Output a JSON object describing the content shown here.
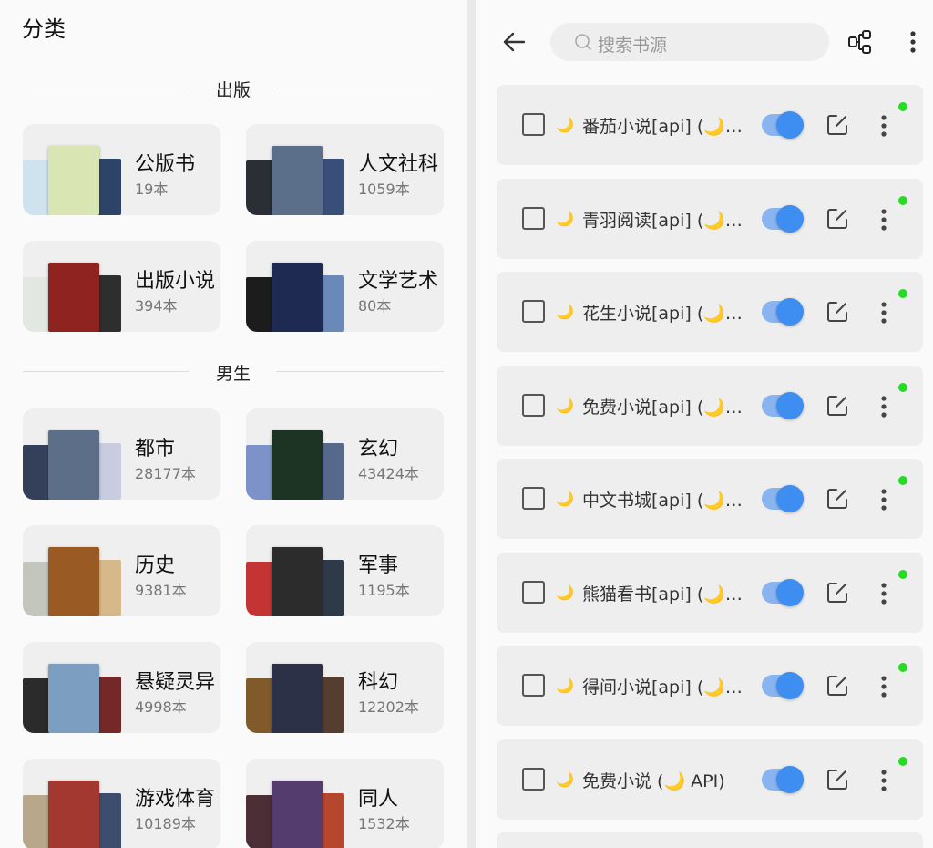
{
  "categories_panel": {
    "title": "分类",
    "sections": [
      {
        "label": "出版",
        "cards": [
          {
            "name": "公版书",
            "count": "19本",
            "covers": [
              "#cfe3ee",
              "#d9e6b4",
              "#2d4368"
            ]
          },
          {
            "name": "人文社科",
            "count": "1059本",
            "covers": [
              "#2a2f36",
              "#5b6f8a",
              "#3a4e7a"
            ]
          },
          {
            "name": "出版小说",
            "count": "394本",
            "covers": [
              "#e3e7e2",
              "#8f2320",
              "#2e2e2e"
            ]
          },
          {
            "name": "文学艺术",
            "count": "80本",
            "covers": [
              "#1c1c1c",
              "#1f2a52",
              "#6a88b8"
            ]
          }
        ]
      },
      {
        "label": "男生",
        "cards": [
          {
            "name": "都市",
            "count": "28177本",
            "covers": [
              "#34405a",
              "#5d6e88",
              "#c9cbe0"
            ]
          },
          {
            "name": "玄幻",
            "count": "43424本",
            "covers": [
              "#7d92c9",
              "#1d3323",
              "#56688c"
            ]
          },
          {
            "name": "历史",
            "count": "9381本",
            "covers": [
              "#c2c6bd",
              "#9a5a23",
              "#d6b98a"
            ]
          },
          {
            "name": "军事",
            "count": "1195本",
            "covers": [
              "#c43434",
              "#2c2c2c",
              "#2f3a48"
            ]
          },
          {
            "name": "悬疑灵异",
            "count": "4998本",
            "covers": [
              "#2b2b2b",
              "#7c9ec0",
              "#742828"
            ]
          },
          {
            "name": "科幻",
            "count": "12202本",
            "covers": [
              "#815a2c",
              "#2d3148",
              "#533e30"
            ]
          },
          {
            "name": "游戏体育",
            "count": "10189本",
            "covers": [
              "#b8a78a",
              "#a2382f",
              "#3c4d6e"
            ]
          },
          {
            "name": "同人",
            "count": "1532本",
            "covers": [
              "#4b2e36",
              "#553c6f",
              "#b7462e"
            ]
          }
        ]
      }
    ]
  },
  "sources_panel": {
    "search_placeholder": "搜索书源",
    "moon_glyph": "🌙",
    "sources": [
      {
        "title": "番茄小说[api] (🌙…",
        "enabled": true,
        "checked": false
      },
      {
        "title": "青羽阅读[api] (🌙…",
        "enabled": true,
        "checked": false
      },
      {
        "title": "花生小说[api] (🌙…",
        "enabled": true,
        "checked": false
      },
      {
        "title": "免费小说[api] (🌙…",
        "enabled": true,
        "checked": false
      },
      {
        "title": "中文书城[api] (🌙…",
        "enabled": true,
        "checked": false
      },
      {
        "title": "熊猫看书[api] (🌙…",
        "enabled": true,
        "checked": false
      },
      {
        "title": "得间小说[api] (🌙…",
        "enabled": true,
        "checked": false
      },
      {
        "title": "免费小说 (🌙 API)",
        "enabled": true,
        "checked": false
      }
    ]
  },
  "colors": {
    "accent": "#3d8ef0",
    "status_dot": "#22dd22",
    "moon": "#f2cb57"
  }
}
